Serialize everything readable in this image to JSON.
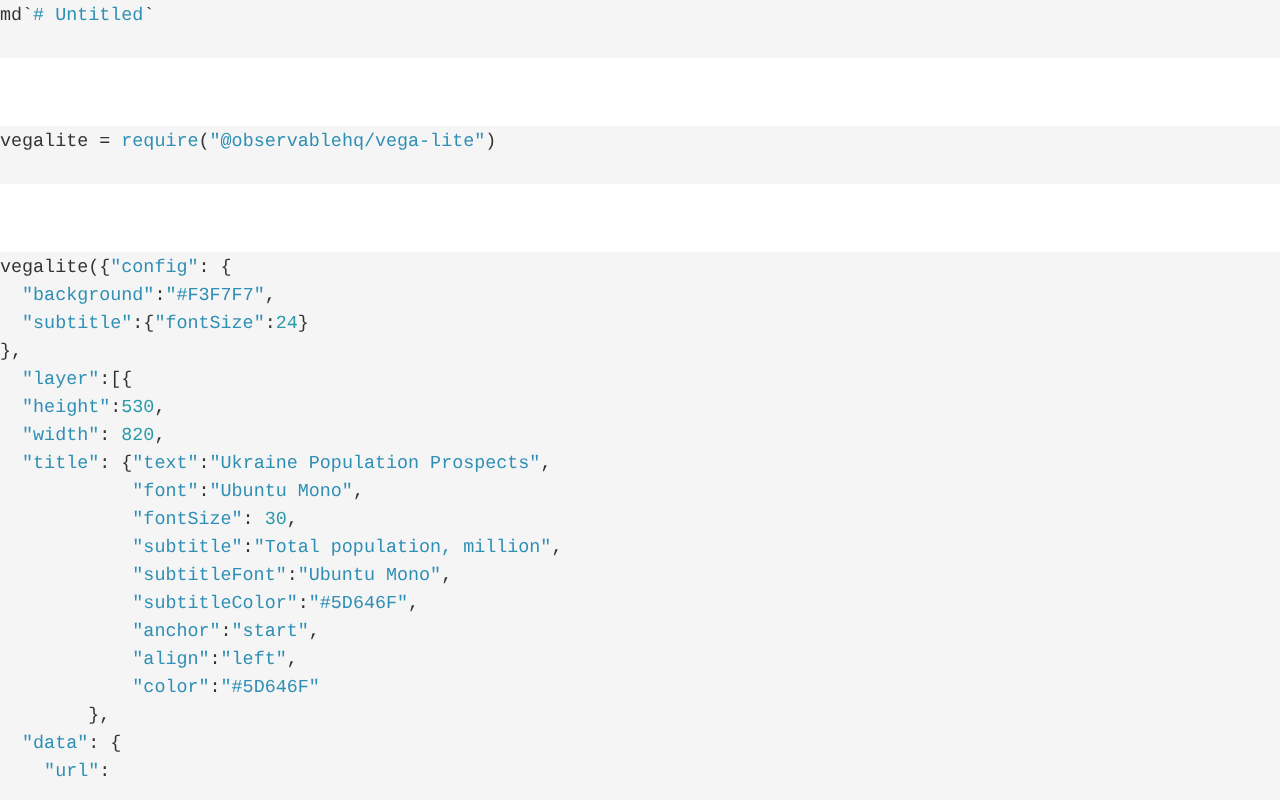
{
  "cells": [
    {
      "kind": "code",
      "lines": [
        [
          {
            "kind": "plain",
            "text": "md`"
          },
          {
            "kind": "string",
            "text": "# Untitled"
          },
          {
            "kind": "plain",
            "text": "`"
          }
        ]
      ]
    },
    {
      "kind": "spacer"
    },
    {
      "kind": "code",
      "lines": [
        [
          {
            "kind": "plain",
            "text": "vegalite = "
          },
          {
            "kind": "call",
            "text": "require"
          },
          {
            "kind": "plain",
            "text": "("
          },
          {
            "kind": "string",
            "text": "\"@observablehq/vega-lite\""
          },
          {
            "kind": "plain",
            "text": ")"
          }
        ]
      ]
    },
    {
      "kind": "spacer"
    },
    {
      "kind": "code",
      "lines": [
        [
          {
            "kind": "plain",
            "text": "vegalite({"
          },
          {
            "kind": "string",
            "text": "\"config\""
          },
          {
            "kind": "plain",
            "text": ": {"
          }
        ],
        [
          {
            "kind": "string",
            "text": "  \"background\""
          },
          {
            "kind": "plain",
            "text": ":"
          },
          {
            "kind": "string",
            "text": "\"#F3F7F7\""
          },
          {
            "kind": "plain",
            "text": ","
          }
        ],
        [
          {
            "kind": "string",
            "text": "  \"subtitle\""
          },
          {
            "kind": "plain",
            "text": ":{"
          },
          {
            "kind": "string",
            "text": "\"fontSize\""
          },
          {
            "kind": "plain",
            "text": ":"
          },
          {
            "kind": "number",
            "text": "24"
          },
          {
            "kind": "plain",
            "text": "}"
          }
        ],
        [
          {
            "kind": "plain",
            "text": "},"
          }
        ],
        [
          {
            "kind": "string",
            "text": "  \"layer\""
          },
          {
            "kind": "plain",
            "text": ":[{"
          }
        ],
        [
          {
            "kind": "string",
            "text": "  \"height\""
          },
          {
            "kind": "plain",
            "text": ":"
          },
          {
            "kind": "number",
            "text": "530"
          },
          {
            "kind": "plain",
            "text": ","
          }
        ],
        [
          {
            "kind": "string",
            "text": "  \"width\""
          },
          {
            "kind": "plain",
            "text": ": "
          },
          {
            "kind": "number",
            "text": "820"
          },
          {
            "kind": "plain",
            "text": ","
          }
        ],
        [
          {
            "kind": "string",
            "text": "  \"title\""
          },
          {
            "kind": "plain",
            "text": ": {"
          },
          {
            "kind": "string",
            "text": "\"text\""
          },
          {
            "kind": "plain",
            "text": ":"
          },
          {
            "kind": "string",
            "text": "\"Ukraine Population Prospects\""
          },
          {
            "kind": "plain",
            "text": ","
          }
        ],
        [
          {
            "kind": "string",
            "text": "            \"font\""
          },
          {
            "kind": "plain",
            "text": ":"
          },
          {
            "kind": "string",
            "text": "\"Ubuntu Mono\""
          },
          {
            "kind": "plain",
            "text": ","
          }
        ],
        [
          {
            "kind": "string",
            "text": "            \"fontSize\""
          },
          {
            "kind": "plain",
            "text": ": "
          },
          {
            "kind": "number",
            "text": "30"
          },
          {
            "kind": "plain",
            "text": ","
          }
        ],
        [
          {
            "kind": "string",
            "text": "            \"subtitle\""
          },
          {
            "kind": "plain",
            "text": ":"
          },
          {
            "kind": "string",
            "text": "\"Total population, million\""
          },
          {
            "kind": "plain",
            "text": ","
          }
        ],
        [
          {
            "kind": "string",
            "text": "            \"subtitleFont\""
          },
          {
            "kind": "plain",
            "text": ":"
          },
          {
            "kind": "string",
            "text": "\"Ubuntu Mono\""
          },
          {
            "kind": "plain",
            "text": ","
          }
        ],
        [
          {
            "kind": "string",
            "text": "            \"subtitleColor\""
          },
          {
            "kind": "plain",
            "text": ":"
          },
          {
            "kind": "string",
            "text": "\"#5D646F\""
          },
          {
            "kind": "plain",
            "text": ","
          }
        ],
        [
          {
            "kind": "string",
            "text": "            \"anchor\""
          },
          {
            "kind": "plain",
            "text": ":"
          },
          {
            "kind": "string",
            "text": "\"start\""
          },
          {
            "kind": "plain",
            "text": ","
          }
        ],
        [
          {
            "kind": "string",
            "text": "            \"align\""
          },
          {
            "kind": "plain",
            "text": ":"
          },
          {
            "kind": "string",
            "text": "\"left\""
          },
          {
            "kind": "plain",
            "text": ","
          }
        ],
        [
          {
            "kind": "string",
            "text": "            \"color\""
          },
          {
            "kind": "plain",
            "text": ":"
          },
          {
            "kind": "string",
            "text": "\"#5D646F\""
          }
        ],
        [
          {
            "kind": "plain",
            "text": "        },"
          }
        ],
        [
          {
            "kind": "string",
            "text": "  \"data\""
          },
          {
            "kind": "plain",
            "text": ": {"
          }
        ],
        [
          {
            "kind": "string",
            "text": "    \"url\""
          },
          {
            "kind": "plain",
            "text": ":"
          }
        ]
      ]
    }
  ]
}
